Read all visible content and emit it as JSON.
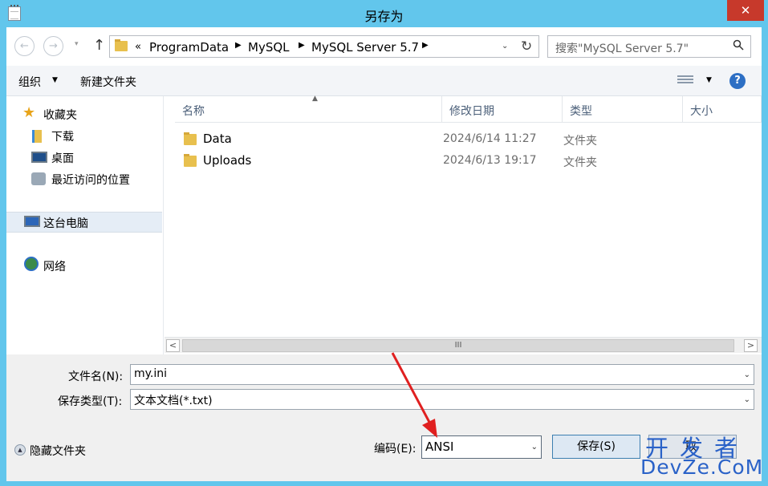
{
  "window": {
    "title": "另存为",
    "close_glyph": "✕"
  },
  "nav": {
    "back_glyph": "←",
    "forward_glyph": "→",
    "up_glyph": "↑",
    "history_glyph": "▾"
  },
  "address": {
    "overflow": "«",
    "crumbs": [
      "ProgramData",
      "MySQL",
      "MySQL Server 5.7"
    ],
    "separator": "▶",
    "dropdown_glyph": "⌄",
    "refresh_glyph": "↻"
  },
  "search": {
    "placeholder": "搜索\"MySQL Server 5.7\"",
    "icon": "search-icon"
  },
  "toolbar": {
    "organize": "组织",
    "organize_arrow": "▼",
    "new_folder": "新建文件夹",
    "view_arrow": "▼",
    "help": "?"
  },
  "sidebar": {
    "favorites": "收藏夹",
    "downloads": "下载",
    "desktop": "桌面",
    "recent": "最近访问的位置",
    "this_pc": "这台电脑",
    "network": "网络"
  },
  "columns": {
    "name": "名称",
    "date": "修改日期",
    "type": "类型",
    "size": "大小",
    "sort_glyph": "▲"
  },
  "files": [
    {
      "name": "Data",
      "date": "2024/6/14 11:27",
      "type": "文件夹"
    },
    {
      "name": "Uploads",
      "date": "2024/6/13 19:17",
      "type": "文件夹"
    }
  ],
  "hscroll": {
    "left": "<",
    "right": ">",
    "grip": "III"
  },
  "form": {
    "filename_label": "文件名(N):",
    "filename_value": "my.ini",
    "filetype_label": "保存类型(T):",
    "filetype_value": "文本文档(*.txt)",
    "encoding_label": "编码(E):",
    "encoding_value": "ANSI",
    "dropdown_glyph": "⌄"
  },
  "footer": {
    "hide_folders": "隐藏文件夹",
    "hide_glyph": "▲",
    "save_button": "保存(S)",
    "cancel_button": "取"
  },
  "watermark": {
    "line1": "开发者",
    "line2": "DevZe.CoM"
  },
  "colors": {
    "titlebar": "#62c6ec",
    "close": "#c7392b",
    "annotation_arrow": "#e02020",
    "watermark": "#2a62c8"
  }
}
